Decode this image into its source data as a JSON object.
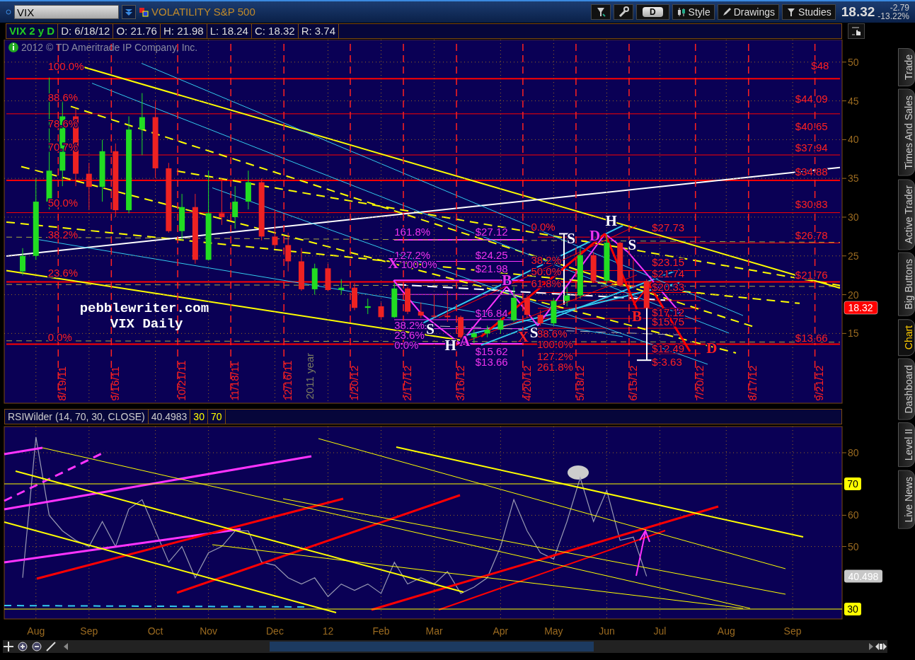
{
  "symbol": {
    "value": "VIX",
    "description": "VOLATILITY S&P 500"
  },
  "toolbar": [
    {
      "kind": "tool"
    },
    {
      "kind": "tool"
    },
    {
      "kind": "period",
      "label": "D"
    },
    {
      "kind": "labeled",
      "label": "Style"
    },
    {
      "kind": "labeled",
      "label": "Drawings"
    },
    {
      "kind": "labeled",
      "label": "Studies"
    }
  ],
  "quote": {
    "last": "18.32",
    "change": "-2.79",
    "percent": "-13.22%"
  },
  "info_bar": {
    "title": "VIX 2 y D",
    "fields": [
      "D: 6/18/12",
      "O: 21.76",
      "H: 21.98",
      "L: 18.24",
      "C: 18.32",
      "R: 3.74"
    ]
  },
  "copyright": "2012 © TD Ameritrade IP Company, Inc.",
  "price_chart": {
    "chart_data": {
      "type": "candlestick",
      "grid": true,
      "ylim": [
        6,
        52.9
      ],
      "yticks": [
        15,
        20,
        25,
        30,
        35,
        40,
        45,
        50
      ],
      "categories": [
        null,
        null,
        null,
        "8/19/11",
        null,
        null,
        null,
        "9/16/11",
        null,
        null,
        null,
        null,
        "10/21/11",
        null,
        null,
        null,
        "11/18/11",
        null,
        null,
        null,
        "12/16/11",
        null,
        null,
        null,
        null,
        "1/20/12",
        null,
        null,
        null,
        "2/17/12",
        null,
        null,
        null,
        "3/16/12",
        null,
        null,
        null,
        null,
        "4/20/12",
        null,
        null,
        null,
        "5/18/12",
        null,
        null,
        null,
        "6/15/12",
        null,
        null,
        null,
        null,
        "7/20/12",
        null,
        null,
        null,
        "8/17/12",
        null,
        null,
        null,
        null,
        "9/21/12",
        null
      ],
      "ohlc": [
        [
          23,
          26,
          22.5,
          25
        ],
        [
          25,
          35,
          24.5,
          32
        ],
        [
          32,
          48,
          31,
          36
        ],
        [
          36,
          45,
          34,
          43
        ],
        [
          43,
          44,
          34,
          35.6
        ],
        [
          35.6,
          37,
          31,
          33.9
        ],
        [
          33.9,
          40,
          32,
          38.5
        ],
        [
          38.5,
          39.5,
          30,
          30.9
        ],
        [
          30.9,
          43,
          30.5,
          41.3
        ],
        [
          41.3,
          46,
          38,
          42.9
        ],
        [
          42.9,
          45,
          35,
          36.3
        ],
        [
          36.3,
          37,
          28,
          28.2
        ],
        [
          28.2,
          33,
          27,
          31.3
        ],
        [
          31.3,
          33,
          24,
          24.5
        ],
        [
          24.5,
          36,
          24.4,
          30.5
        ],
        [
          30.5,
          35,
          29,
          30
        ],
        [
          30,
          34,
          28.5,
          32
        ],
        [
          32,
          36,
          31,
          34.5
        ],
        [
          34.5,
          35,
          27,
          27.5
        ],
        [
          27.5,
          31,
          26,
          26.4
        ],
        [
          26.4,
          28,
          23,
          24.3
        ],
        [
          24.3,
          26,
          20.5,
          20.7
        ],
        [
          20.7,
          24,
          20,
          23.4
        ],
        [
          23.4,
          24,
          20.5,
          20.6
        ],
        [
          20.6,
          22,
          20,
          20.9
        ],
        [
          20.9,
          21.5,
          18,
          18.3
        ],
        [
          18.3,
          19.5,
          17.5,
          18.5
        ],
        [
          18.5,
          19,
          16.8,
          17.1
        ],
        [
          17.1,
          21.5,
          17,
          20.8
        ],
        [
          20.8,
          21,
          17.5,
          17.8
        ],
        [
          17.8,
          19,
          17,
          17.3
        ],
        [
          17.3,
          20,
          17,
          17.3
        ],
        [
          17.3,
          20.5,
          16.5,
          17.1
        ],
        [
          17.1,
          17.3,
          14.3,
          14.5
        ],
        [
          14.5,
          15.5,
          13.7,
          15
        ],
        [
          15,
          16,
          14.5,
          15.5
        ],
        [
          15.5,
          17,
          15,
          16.7
        ],
        [
          16.7,
          21,
          16.5,
          19.6
        ],
        [
          19.6,
          20,
          17,
          17.4
        ],
        [
          17.4,
          18,
          16,
          16.3
        ],
        [
          16.3,
          19.5,
          16,
          19.2
        ],
        [
          19.2,
          21,
          18.5,
          19.9
        ],
        [
          19.9,
          26,
          19.5,
          25.1
        ],
        [
          25.1,
          25.5,
          21.5,
          21.8
        ],
        [
          21.8,
          27.7,
          21.5,
          26.7
        ],
        [
          26.7,
          26.8,
          21,
          21.2
        ],
        [
          21.2,
          24.5,
          20.8,
          21.1
        ],
        [
          21.76,
          21.98,
          18.24,
          18.32
        ],
        null,
        null,
        null,
        null,
        null,
        null,
        null,
        null,
        null,
        null,
        null,
        null,
        null,
        null
      ]
    },
    "level_labels": [
      {
        "text": "$48",
        "color": "#ff2020"
      },
      {
        "text": "$44.09",
        "color": "#ff2020"
      },
      {
        "text": "$40.65",
        "color": "#ff2020"
      },
      {
        "text": "$37.94",
        "color": "#ff2020"
      },
      {
        "text": "$34.88",
        "color": "#ff2020"
      },
      {
        "text": "$30.83",
        "color": "#ff2020"
      },
      {
        "text": "$26.78",
        "color": "#ff2020"
      },
      {
        "text": "$21.76",
        "color": "#ff2020"
      },
      {
        "text": "$13.66",
        "color": "#ff2020"
      },
      {
        "text": "$27.73",
        "color": "#ff2020"
      },
      {
        "text": "$23.15",
        "color": "#ff2020"
      },
      {
        "text": "$21.74",
        "color": "#ff2020"
      },
      {
        "text": "$20.33",
        "color": "#ff2020"
      },
      {
        "text": "$17.12",
        "color": "#ff2020"
      },
      {
        "text": "$15.75",
        "color": "#ff2020"
      },
      {
        "text": "$12.49",
        "color": "#ff2020"
      },
      {
        "text": "$-3.63",
        "color": "#ff2020"
      },
      {
        "text": "100.0%",
        "color": "#ff2020"
      },
      {
        "text": "88.6%",
        "color": "#ff2020"
      },
      {
        "text": "78.6%",
        "color": "#ff2020"
      },
      {
        "text": "70.7%",
        "color": "#ff2020"
      },
      {
        "text": "50.0%",
        "color": "#ff2020"
      },
      {
        "text": "38.2%",
        "color": "#ff2020"
      },
      {
        "text": "23.6%",
        "color": "#ff2020"
      },
      {
        "text": "0.0%",
        "color": "#ff2020"
      },
      {
        "text": "161.8%",
        "color": "#ee33ee"
      },
      {
        "text": "127.2%",
        "color": "#ee33ee"
      },
      {
        "text": "100.0%",
        "color": "#ee33ee"
      },
      {
        "text": "38.2%",
        "color": "#ee33ee"
      },
      {
        "text": "23.6%",
        "color": "#ee33ee"
      },
      {
        "text": "0.0%",
        "color": "#ee33ee"
      },
      {
        "text": "$27.12",
        "color": "#ee33ee"
      },
      {
        "text": "$24.25",
        "color": "#ee33ee"
      },
      {
        "text": "$21.98",
        "color": "#ee33ee"
      },
      {
        "text": "$16.84",
        "color": "#ee33ee"
      },
      {
        "text": "$15.62",
        "color": "#ee33ee"
      },
      {
        "text": "$13.66",
        "color": "#ee33ee"
      },
      {
        "text": "0.0%",
        "color": "#ff2020"
      },
      {
        "text": "38.2%",
        "color": "#ff2020"
      },
      {
        "text": "50.0%",
        "color": "#ff2020"
      },
      {
        "text": "61.8%",
        "color": "#ff2020"
      },
      {
        "text": "88.6%",
        "color": "#ff2020"
      },
      {
        "text": "100.0%",
        "color": "#ff2020"
      },
      {
        "text": "127.2%",
        "color": "#ff2020"
      },
      {
        "text": "261.8%",
        "color": "#ff2020"
      }
    ],
    "pattern_letters": [
      {
        "text": "H",
        "color": "#ffffff"
      },
      {
        "text": "S",
        "color": "#ffffff"
      },
      {
        "text": "S",
        "color": "#ffffff"
      },
      {
        "text": "S",
        "color": "#ffffff"
      },
      {
        "text": "S",
        "color": "#ffffff"
      },
      {
        "text": "H",
        "color": "#ffffff"
      },
      {
        "text": "X",
        "color": "#ee33ee"
      },
      {
        "text": "B",
        "color": "#ee33ee"
      },
      {
        "text": "A",
        "color": "#ee33ee"
      },
      {
        "text": "D",
        "color": "#ee33ee"
      },
      {
        "text": "B",
        "color": "#ff2020"
      },
      {
        "text": "X",
        "color": "#ff2020"
      },
      {
        "text": "D",
        "color": "#ff2020"
      }
    ],
    "notes": [
      "pebblewriter.com",
      "VIX Daily"
    ],
    "year_label": "2011 year",
    "last_price_tag": "18.32"
  },
  "rsi": {
    "value": "40.4983",
    "levels": [
      "30",
      "70"
    ],
    "chart_data": {
      "type": "line",
      "grid": true,
      "ylim": [
        26.83,
        88.37
      ],
      "yticks": [
        50,
        60,
        80
      ],
      "categories": [
        null,
        "Aug",
        null,
        null,
        null,
        "Sep",
        null,
        null,
        null,
        null,
        "Oct",
        null,
        null,
        null,
        "Nov",
        null,
        null,
        null,
        null,
        "Dec",
        null,
        null,
        null,
        "12",
        null,
        null,
        null,
        "Feb",
        null,
        null,
        null,
        "Mar",
        null,
        null,
        null,
        null,
        "Apr",
        null,
        null,
        null,
        "May",
        null,
        null,
        null,
        "Jun",
        null,
        null,
        null,
        "Jul",
        null,
        null,
        null,
        null,
        "Aug",
        null,
        null,
        null,
        null,
        "Sep",
        null,
        null,
        null
      ],
      "series": [
        {
          "name": "RSIWilder (14, 70, 30, CLOSE)",
          "color": "#9a9ab4",
          "values": [
            40,
            85,
            60,
            55,
            52,
            50,
            58,
            50,
            62,
            65,
            55,
            45,
            50,
            40,
            48,
            50,
            55,
            55,
            45,
            44,
            40,
            38,
            40,
            34,
            38,
            36,
            38,
            35,
            45,
            38,
            40,
            38,
            42,
            35,
            37,
            40,
            50,
            65,
            55,
            48,
            46,
            58,
            72,
            58,
            68,
            52,
            53,
            40.5,
            null,
            null,
            null,
            null,
            null,
            null,
            null,
            null,
            null,
            null,
            null,
            null,
            null,
            null
          ]
        }
      ]
    },
    "level_tags": [
      "70",
      "30"
    ],
    "value_tag": "40.498"
  },
  "sidebar_tabs": [
    {
      "label": "Trade",
      "selected": false
    },
    {
      "label": "Times And Sales",
      "selected": false
    },
    {
      "label": "Active Trader",
      "selected": false
    },
    {
      "label": "Big Buttons",
      "selected": false
    },
    {
      "label": "Chart",
      "selected": true
    },
    {
      "label": "Dashboard",
      "selected": false
    },
    {
      "label": "Level II",
      "selected": false
    },
    {
      "label": "Live News",
      "selected": false
    }
  ]
}
